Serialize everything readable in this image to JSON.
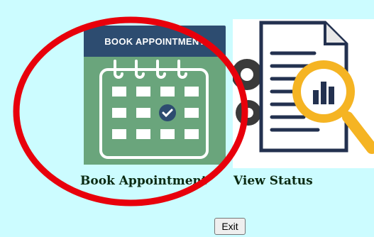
{
  "tiles": {
    "book": {
      "banner": "BOOK APPOINTMENT",
      "caption": "Book Appointment"
    },
    "status": {
      "caption": "View Status"
    }
  },
  "exit_label": "Exit",
  "colors": {
    "background": "#ccfcff",
    "banner": "#2d4c70",
    "calendar_green": "#6aa57c",
    "check": "#2d4c70",
    "annotation_ring": "#e8000b",
    "magnifier": "#f5b423"
  },
  "icons": [
    "calendar-check-icon",
    "document-search-icon"
  ]
}
